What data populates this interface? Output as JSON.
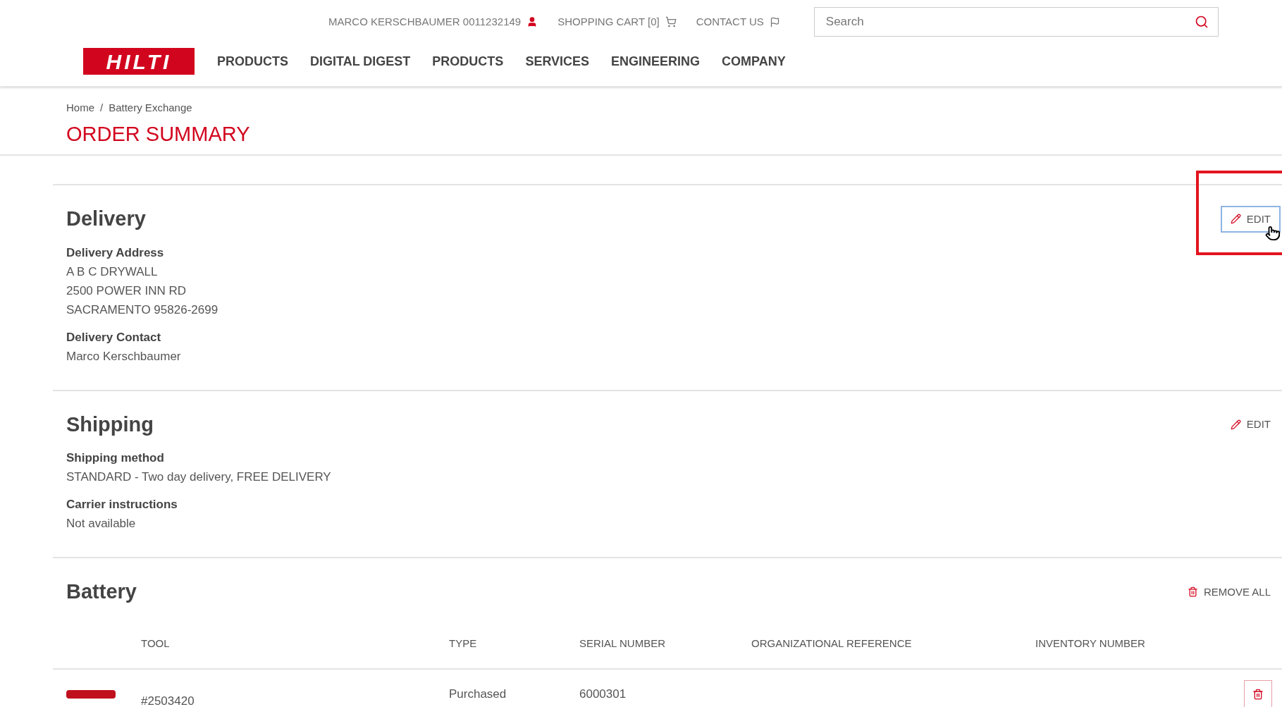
{
  "top_bar": {
    "user": "MARCO  KERSCHBAUMER 0011232149",
    "cart": "SHOPPING CART [0]",
    "contact": "CONTACT US",
    "search": {
      "placeholder": "Search"
    }
  },
  "logo": "HILTI",
  "nav": [
    "PRODUCTS",
    "DIGITAL DIGEST",
    "PRODUCTS",
    "SERVICES",
    "ENGINEERING",
    "COMPANY"
  ],
  "breadcrumb": {
    "items": [
      "Home",
      "Battery Exchange"
    ],
    "separator": "/"
  },
  "page_title": "ORDER SUMMARY",
  "sections": [
    {
      "title": "Delivery",
      "action": {
        "kind": "edit",
        "label": "EDIT",
        "highlighted": true
      },
      "fields": [
        {
          "label": "Delivery Address",
          "lines": [
            "A B C DRYWALL",
            "2500 POWER INN RD",
            "SACRAMENTO 95826-2699"
          ]
        },
        {
          "label": "Delivery Contact",
          "lines": [
            "Marco Kerschbaumer"
          ]
        }
      ]
    },
    {
      "title": "Shipping",
      "action": {
        "kind": "edit",
        "label": "EDIT",
        "highlighted": false
      },
      "fields": [
        {
          "label": "Shipping method",
          "lines": [
            "STANDARD - Two day delivery, FREE DELIVERY"
          ]
        },
        {
          "label": "Carrier instructions",
          "lines": [
            "Not available"
          ]
        }
      ]
    }
  ],
  "battery": {
    "title": "Battery",
    "action": {
      "kind": "remove",
      "label": "REMOVE ALL"
    },
    "table": {
      "columns": [
        "TOOL",
        "TYPE",
        "SERIAL NUMBER",
        "ORGANIZATIONAL REFERENCE",
        "INVENTORY NUMBER"
      ],
      "rows": [
        {
          "tool": "#2503420",
          "type": "Purchased",
          "serial": "6000301"
        }
      ]
    }
  }
}
